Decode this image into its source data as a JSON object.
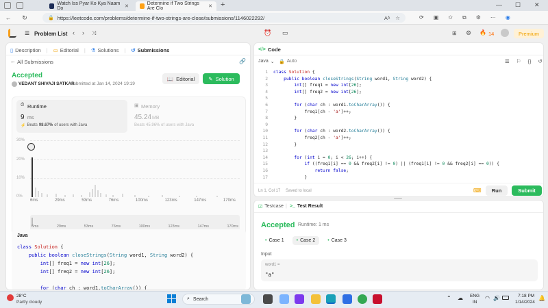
{
  "browser": {
    "tabs": [
      {
        "title": "Watch Iss Pyar Ko Kya Naam Do"
      },
      {
        "title": "Determine if Two Strings Are Clo"
      }
    ],
    "url": "https://leetcode.com/problems/determine-if-two-strings-are-close/submissions/1146022292/",
    "reader_icon": "Aᴬ",
    "new_tab": "+"
  },
  "header": {
    "problem_list": "Problem List",
    "streak": "14",
    "premium": "Premium"
  },
  "left": {
    "tabs": [
      "Description",
      "Editorial",
      "Solutions",
      "Submissions"
    ],
    "all_submissions": "All Submissions",
    "status": "Accepted",
    "user": "VEDANT SHIVAJI SATKAR",
    "submitted": "submitted at Jan 14, 2024 19:19",
    "editorial_btn": "Editorial",
    "solution_btn": "Solution",
    "runtime_label": "Runtime",
    "runtime_value": "9",
    "runtime_unit": "ms",
    "beats_runtime_prefix": "Beats",
    "beats_runtime_pct": "98.67%",
    "beats_runtime_suffix": "of users with Java",
    "memory_label": "Memory",
    "memory_value": "45.24",
    "memory_unit": "MB",
    "beats_memory": "Beats 45.96% of users with Java",
    "y_ticks": [
      "30%",
      "20%",
      "10%",
      "0%"
    ],
    "x_ticks": [
      "6ms",
      "29ms",
      "53ms",
      "76ms",
      "100ms",
      "123ms",
      "147ms",
      "170ms"
    ],
    "lang": "Java"
  },
  "editor": {
    "title": "Code",
    "lang": "Java",
    "auto": "Auto",
    "position": "Ln 1, Col 17",
    "saved": "Saved to local",
    "run": "Run",
    "submit": "Submit"
  },
  "result": {
    "testcase_tab": "Testcase",
    "result_tab": "Test Result",
    "status": "Accepted",
    "runtime": "Runtime: 1 ms",
    "cases": [
      "Case 1",
      "Case 2",
      "Case 3"
    ],
    "input_label": "Input",
    "var_name": "word1 =",
    "var_value": "\"a\""
  },
  "taskbar": {
    "temp": "28°C",
    "weather": "Partly cloudy",
    "search": "Search",
    "lang1": "ENG",
    "lang2": "IN",
    "time": "7:18 PM",
    "date": "1/14/2024"
  }
}
